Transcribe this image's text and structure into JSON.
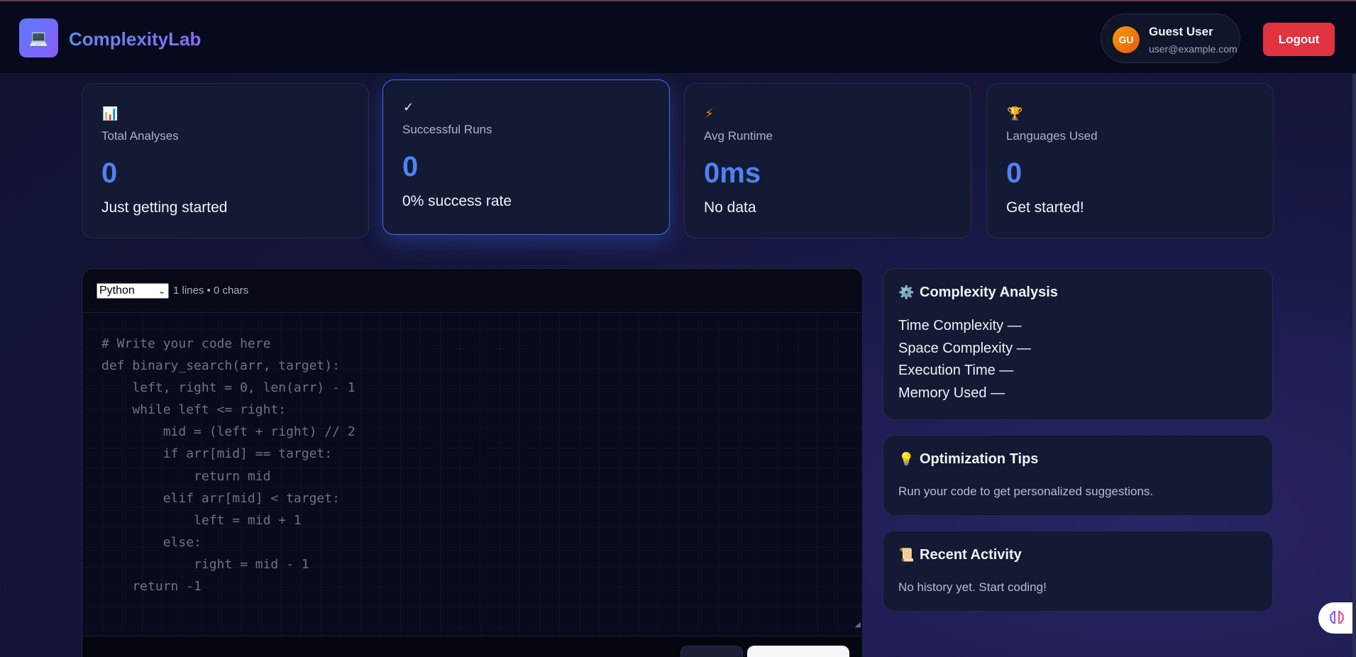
{
  "app": {
    "title": "ComplexityLab",
    "logo_icon": "laptop-icon"
  },
  "user": {
    "initials": "GU",
    "name": "Guest User",
    "email": "user@example.com",
    "logout_label": "Logout"
  },
  "stats": [
    {
      "icon": "📊",
      "icon_name": "bar-chart-icon",
      "label": "Total Analyses",
      "value": "0",
      "sub": "Just getting started"
    },
    {
      "icon": "✓",
      "icon_name": "check-icon",
      "label": "Successful Runs",
      "value": "0",
      "sub": "0% success rate"
    },
    {
      "icon": "⚡",
      "icon_name": "lightning-icon",
      "label": "Avg Runtime",
      "value": "0ms",
      "sub": "No data"
    },
    {
      "icon": "🏆",
      "icon_name": "trophy-icon",
      "label": "Languages Used",
      "value": "0",
      "sub": "Get started!"
    }
  ],
  "editor": {
    "language": "Python",
    "meta": "1 lines • 0 chars",
    "placeholder_code": "# Write your code here\ndef binary_search(arr, target):\n    left, right = 0, len(arr) - 1\n    while left <= right:\n        mid = (left + right) // 2\n        if arr[mid] == target:\n            return mid\n        elif arr[mid] < target:\n            left = mid + 1\n        else:\n            right = mid - 1\n    return -1"
  },
  "complexity": {
    "icon": "⚙️",
    "title": "Complexity Analysis",
    "time": "Time Complexity —",
    "space": "Space Complexity —",
    "exec": "Execution Time —",
    "memory": "Memory Used —"
  },
  "tips": {
    "icon": "💡",
    "title": "Optimization Tips",
    "text": "Run your code to get personalized suggestions."
  },
  "activity": {
    "icon": "📜",
    "title": "Recent Activity",
    "text": "No history yet. Start coding!"
  },
  "colors": {
    "accent": "#4f82f0",
    "logout": "#e0333f",
    "active_border": "#3b6df0"
  }
}
